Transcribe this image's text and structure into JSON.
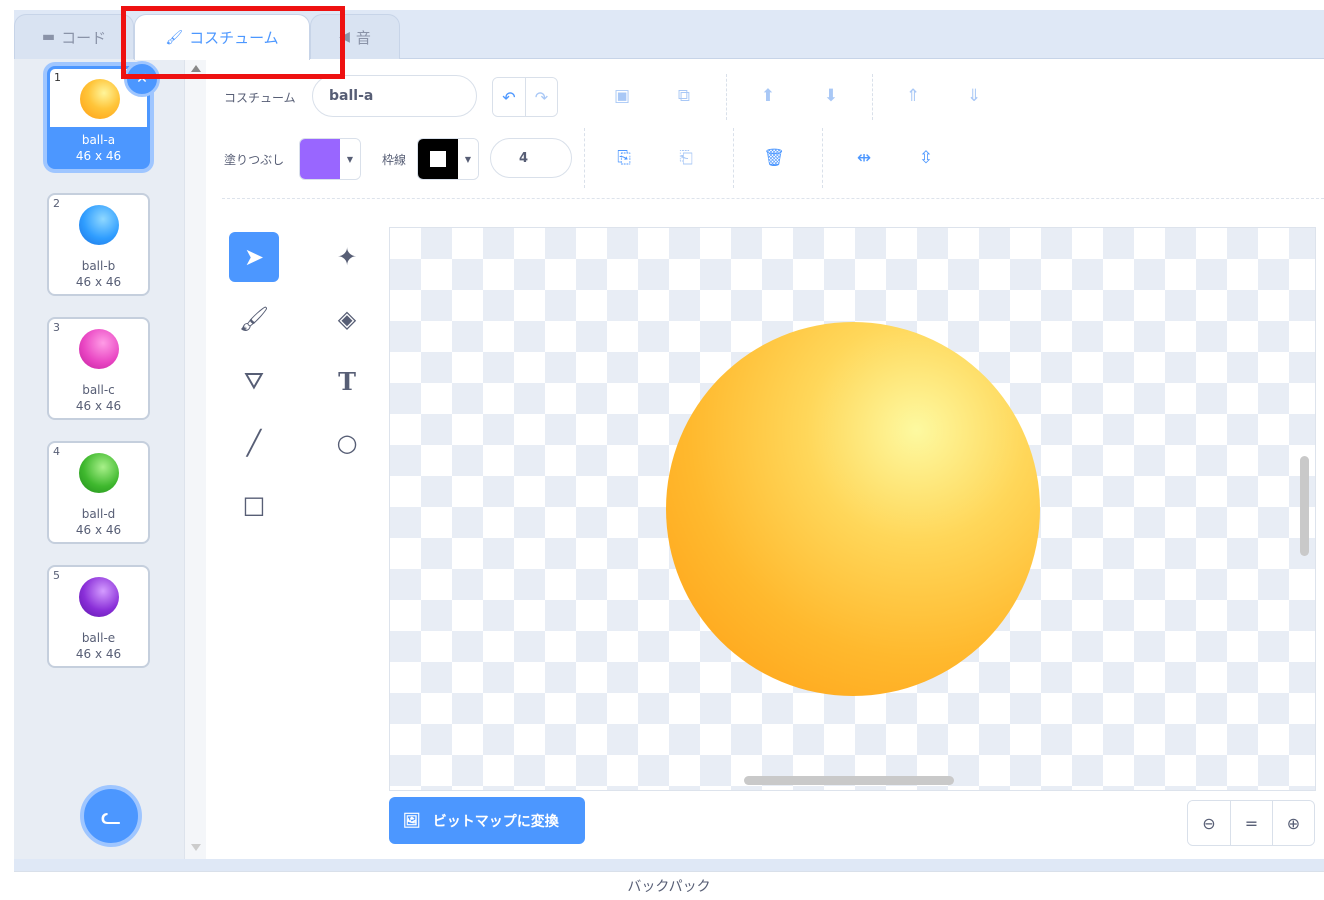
{
  "tabs": {
    "code": {
      "label": "コード",
      "icon": "code-blocks-icon"
    },
    "costume": {
      "label": "コスチューム",
      "icon": "paintbrush-icon"
    },
    "sound": {
      "label": "音",
      "icon": "speaker-icon"
    }
  },
  "costumes": [
    {
      "num": "1",
      "name": "ball-a",
      "size": "46 x 46",
      "color": "#ffb92e"
    },
    {
      "num": "2",
      "name": "ball-b",
      "size": "46 x 46",
      "color": "#2f9dff"
    },
    {
      "num": "3",
      "name": "ball-c",
      "size": "46 x 46",
      "color": "#e946c3"
    },
    {
      "num": "4",
      "name": "ball-d",
      "size": "46 x 46",
      "color": "#3fb82e"
    },
    {
      "num": "5",
      "name": "ball-e",
      "size": "46 x 46",
      "color": "#8a2fd8"
    }
  ],
  "toolbar": {
    "costume_label": "コスチューム",
    "costume_name": "ball-a",
    "fill_label": "塗りつぶし",
    "fill_color": "#9966ff",
    "outline_label": "枠線",
    "outline_color": "#000000",
    "outline_width": "4"
  },
  "canvas": {
    "convert_button": "ビットマップに変換"
  },
  "backpack": {
    "label": "バックパック"
  },
  "colors": {
    "accent": "#4c97ff",
    "highlight_box": "#ee1111"
  }
}
